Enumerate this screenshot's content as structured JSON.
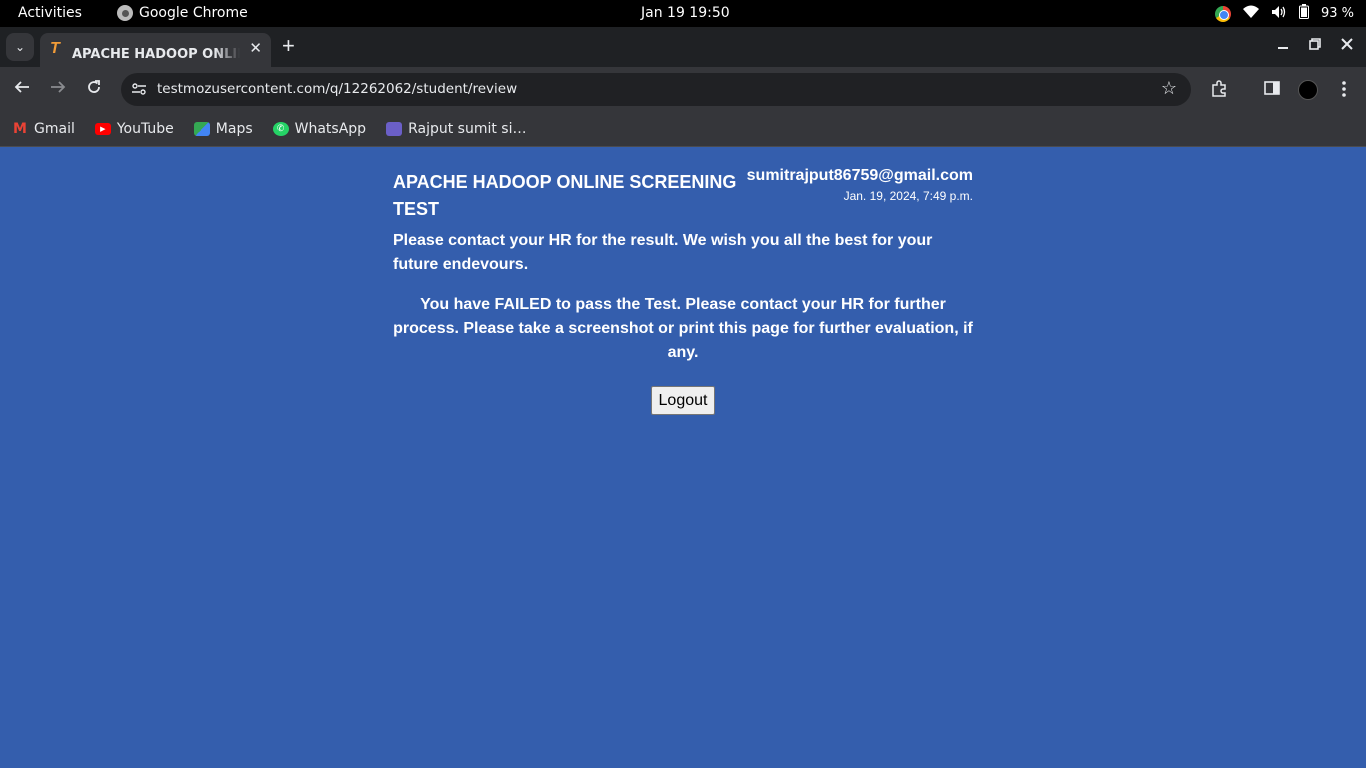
{
  "system_bar": {
    "activities": "Activities",
    "app_name": "Google Chrome",
    "clock": "Jan 19  19:50",
    "battery": "93 %"
  },
  "browser": {
    "tab_title": "APACHE HADOOP ONLINE SCREENING TEST",
    "tab_close": "✕",
    "new_tab": "+",
    "url": "testmozusercontent.com/q/12262062/student/review",
    "bookmarks": [
      {
        "label": "Gmail",
        "icon": "gmail-icon"
      },
      {
        "label": "YouTube",
        "icon": "youtube-icon"
      },
      {
        "label": "Maps",
        "icon": "maps-icon"
      },
      {
        "label": "WhatsApp",
        "icon": "whatsapp-icon"
      },
      {
        "label": "Rajput sumit si…",
        "icon": "bookmark-page-icon"
      }
    ]
  },
  "page": {
    "background_color": "#345ead",
    "test_title": "APACHE HADOOP ONLINE SCREENING TEST",
    "user_email": "sumitrajput86759@gmail.com",
    "submitted_at": "Jan. 19, 2024, 7:49 p.m.",
    "message_contact": "Please contact your HR for the result. We wish you all the best for your future endevours.",
    "message_result": "You have FAILED to pass the Test. Please contact your HR for further process. Please take a screenshot or print this page for further evaluation, if any.",
    "logout_label": "Logout"
  }
}
